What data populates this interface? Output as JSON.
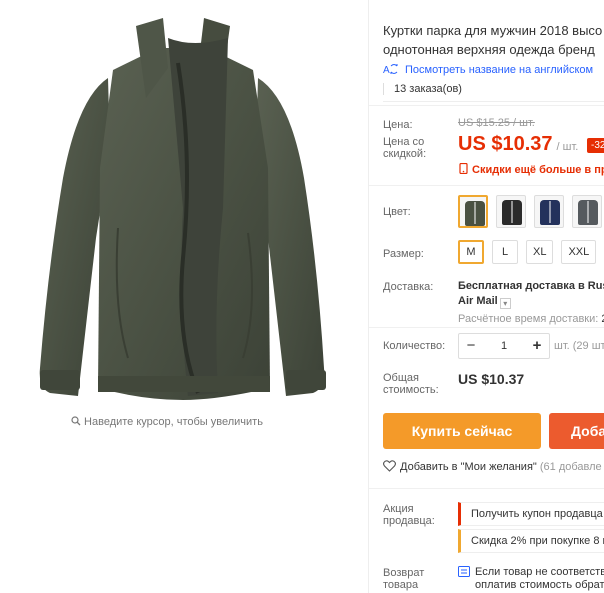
{
  "image": {
    "zoom_hint": "Наведите курсор, чтобы увеличить"
  },
  "product": {
    "title_line1": "Куртки парка для мужчин 2018 высо",
    "title_line2": "однотонная верхняя одежда бренд",
    "translate_link": "Посмотреть название на английском",
    "orders": "13 заказа(ов)"
  },
  "price": {
    "label": "Цена:",
    "old_price": "US $15.25 / шт.",
    "discount_label": "Цена со скидкой:",
    "current": "US $10.37",
    "unit": "/ шт.",
    "discount_badge": "-32%",
    "promo": "Скидки ещё больше в при"
  },
  "color": {
    "label": "Цвет:",
    "options": [
      {
        "name": "army-green",
        "color": "#4a5142"
      },
      {
        "name": "black",
        "color": "#2b2b2b"
      },
      {
        "name": "navy",
        "color": "#24325c"
      },
      {
        "name": "gray",
        "color": "#555a5e"
      }
    ],
    "selected_index": 0
  },
  "size": {
    "label": "Размер:",
    "options": [
      "M",
      "L",
      "XL",
      "XXL"
    ],
    "selected": "M"
  },
  "shipping": {
    "label": "Доставка:",
    "main": "Бесплатная доставка в Russ",
    "method": "Air Mail",
    "time_label": "Расчётное время доставки:",
    "time_value": "2"
  },
  "quantity": {
    "label": "Количество:",
    "minus": "−",
    "value": "1",
    "plus": "+",
    "note": "шт. (29 шт."
  },
  "total": {
    "label": "Общая стоимость:",
    "value": "US $10.37"
  },
  "buttons": {
    "buy_now": "Купить сейчас",
    "add_to_cart": "Доба"
  },
  "wishlist": {
    "text": "Добавить в \"Мои желания\"",
    "count": "(61 добавле"
  },
  "seller_promo": {
    "label": "Акция продавца:",
    "coupon": "Получить купон продавца",
    "discount": "Скидка 2% при покупке 8 ш"
  },
  "returns": {
    "label": "Возврат товара",
    "line1": "Если товар не соответству",
    "line2": "оплатив стоимость обратн"
  },
  "colors": {
    "price_red": "#e62e04",
    "link_blue": "#2962ff",
    "buy_now": "#f49a29",
    "add_cart": "#ec5b2e",
    "selected_border": "#f0a830"
  }
}
